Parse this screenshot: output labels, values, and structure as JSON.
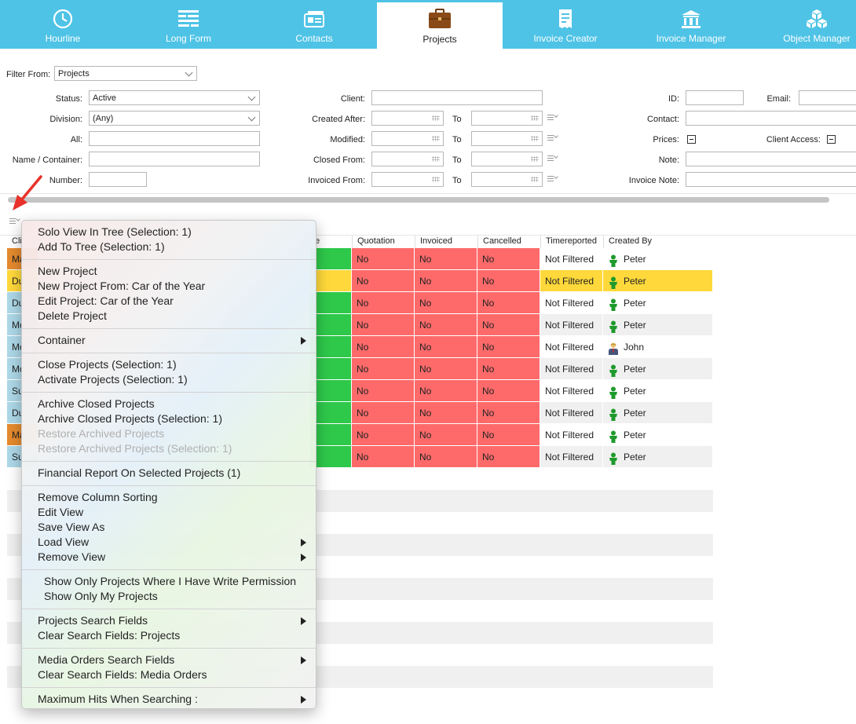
{
  "nav": {
    "tabs": [
      {
        "label": "Hourline",
        "icon": "clock-icon"
      },
      {
        "label": "Long Form",
        "icon": "long-form-icon"
      },
      {
        "label": "Contacts",
        "icon": "contacts-icon"
      },
      {
        "label": "Projects",
        "icon": "briefcase-icon",
        "active": true
      },
      {
        "label": "Invoice Creator",
        "icon": "invoice-icon"
      },
      {
        "label": "Invoice Manager",
        "icon": "bank-icon"
      },
      {
        "label": "Object Manager",
        "icon": "cubes-icon"
      }
    ]
  },
  "filter": {
    "filter_from_label": "Filter From:",
    "filter_from_value": "Projects",
    "status_label": "Status:",
    "status_value": "Active",
    "division_label": "Division:",
    "division_value": "(Any)",
    "all_label": "All:",
    "name_container_label": "Name / Container:",
    "number_label": "Number:",
    "client_label": "Client:",
    "created_after_label": "Created After:",
    "modified_label": "Modified:",
    "closed_from_label": "Closed From:",
    "invoiced_from_label": "Invoiced From:",
    "to_label": "To",
    "id_label": "ID:",
    "email_label": "Email:",
    "contact_label": "Contact:",
    "prices_label": "Prices:",
    "client_access_label": "Client Access:",
    "note_label": "Note:",
    "invoice_note_label": "Invoice Note:"
  },
  "table": {
    "headers": {
      "first": "Cli",
      "partial": "e",
      "quotation": "Quotation",
      "invoiced": "Invoiced",
      "cancelled": "Cancelled",
      "timereported": "Timereported",
      "created_by": "Created By"
    },
    "rows": [
      {
        "client": "Ma",
        "client_color": "#e58a2e",
        "status_color": "#2ec84a",
        "quotation": "No",
        "invoiced": "No",
        "cancelled": "No",
        "timereported": "Not Filtered",
        "created_by": "Peter",
        "avatar": "person-green-icon",
        "highlight": ""
      },
      {
        "client": "Du",
        "client_color": "#ffd93b",
        "status_color": "#ffd93b",
        "quotation": "No",
        "invoiced": "No",
        "cancelled": "No",
        "timereported": "Not Filtered",
        "created_by": "Peter",
        "avatar": "person-green-icon",
        "highlight": "#ffd93b"
      },
      {
        "client": "Du",
        "client_color": "#add8e8",
        "status_color": "#2ec84a",
        "quotation": "No",
        "invoiced": "No",
        "cancelled": "No",
        "timereported": "Not Filtered",
        "created_by": "Peter",
        "avatar": "person-green-icon",
        "highlight": ""
      },
      {
        "client": "Mo",
        "client_color": "#add8e8",
        "status_color": "#2ec84a",
        "quotation": "No",
        "invoiced": "No",
        "cancelled": "No",
        "timereported": "Not Filtered",
        "created_by": "Peter",
        "avatar": "person-green-icon",
        "highlight": "#f0f0f0"
      },
      {
        "client": "Mo",
        "client_color": "#add8e8",
        "status_color": "#2ec84a",
        "quotation": "No",
        "invoiced": "No",
        "cancelled": "No",
        "timereported": "Not Filtered",
        "created_by": "John",
        "avatar": "person-business-icon",
        "highlight": ""
      },
      {
        "client": "Mo",
        "client_color": "#add8e8",
        "status_color": "#2ec84a",
        "quotation": "No",
        "invoiced": "No",
        "cancelled": "No",
        "timereported": "Not Filtered",
        "created_by": "Peter",
        "avatar": "person-green-icon",
        "highlight": "#f0f0f0"
      },
      {
        "client": "Su",
        "client_color": "#add8e8",
        "status_color": "#2ec84a",
        "quotation": "No",
        "invoiced": "No",
        "cancelled": "No",
        "timereported": "Not Filtered",
        "created_by": "Peter",
        "avatar": "person-green-icon",
        "highlight": ""
      },
      {
        "client": "Du",
        "client_color": "#add8e8",
        "status_color": "#2ec84a",
        "quotation": "No",
        "invoiced": "No",
        "cancelled": "No",
        "timereported": "Not Filtered",
        "created_by": "Peter",
        "avatar": "person-green-icon",
        "highlight": "#f0f0f0"
      },
      {
        "client": "Ma",
        "client_color": "#e58a2e",
        "status_color": "#2ec84a",
        "quotation": "No",
        "invoiced": "No",
        "cancelled": "No",
        "timereported": "Not Filtered",
        "created_by": "Peter",
        "avatar": "person-green-icon",
        "highlight": ""
      },
      {
        "client": "Su",
        "client_color": "#add8e8",
        "status_color": "#2ec84a",
        "quotation": "No",
        "invoiced": "No",
        "cancelled": "No",
        "timereported": "Not Filtered",
        "created_by": "Peter",
        "avatar": "person-green-icon",
        "highlight": "#f0f0f0"
      }
    ]
  },
  "context_menu": {
    "groups": [
      [
        {
          "label": "Solo View In Tree (Selection: 1)"
        },
        {
          "label": "Add To Tree (Selection: 1)"
        }
      ],
      [
        {
          "label": "New Project"
        },
        {
          "label": "New Project From: Car of the Year"
        },
        {
          "label": "Edit Project: Car of the Year"
        },
        {
          "label": "Delete Project"
        }
      ],
      [
        {
          "label": "Container",
          "submenu": true
        }
      ],
      [
        {
          "label": "Close Projects (Selection: 1)"
        },
        {
          "label": "Activate Projects (Selection: 1)"
        }
      ],
      [
        {
          "label": "Archive Closed Projects"
        },
        {
          "label": "Archive Closed Projects (Selection: 1)"
        },
        {
          "label": "Restore Archived Projects",
          "disabled": true
        },
        {
          "label": "Restore Archived Projects (Selection: 1)",
          "disabled": true
        }
      ],
      [
        {
          "label": "Financial Report On Selected Projects (1)"
        }
      ],
      [
        {
          "label": "Remove Column Sorting"
        },
        {
          "label": "Edit View"
        },
        {
          "label": "Save View As"
        },
        {
          "label": "Load View",
          "submenu": true
        },
        {
          "label": "Remove View",
          "submenu": true
        }
      ],
      [
        {
          "label": "Show Only Projects Where I Have Write Permission",
          "indent": true
        },
        {
          "label": "Show Only My Projects",
          "indent": true
        }
      ],
      [
        {
          "label": "Projects Search Fields",
          "submenu": true
        },
        {
          "label": "Clear Search Fields: Projects"
        }
      ],
      [
        {
          "label": "Media Orders Search Fields",
          "submenu": true
        },
        {
          "label": "Clear Search Fields: Media Orders"
        }
      ],
      [
        {
          "label": "Maximum Hits When Searching :",
          "submenu": true
        }
      ]
    ]
  },
  "colors": {
    "nav": "#4ec3e6",
    "red": "#fe6a6a",
    "green": "#2ec84a",
    "yellow": "#ffd93b",
    "annotation_arrow": "#e8312a"
  }
}
